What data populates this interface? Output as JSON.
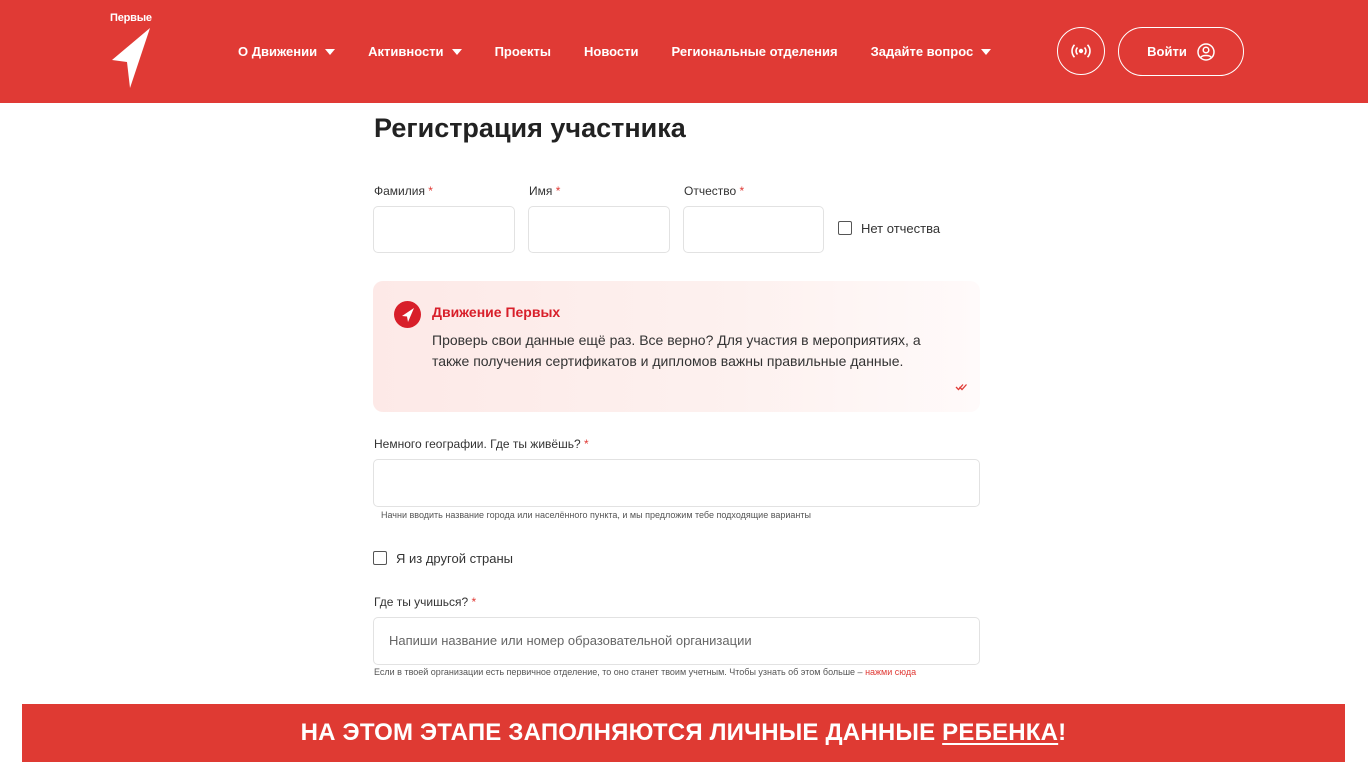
{
  "header": {
    "logo_text": "Первые",
    "nav": [
      {
        "label": "О Движении",
        "dropdown": true
      },
      {
        "label": "Активности",
        "dropdown": true
      },
      {
        "label": "Проекты",
        "dropdown": false
      },
      {
        "label": "Новости",
        "dropdown": false
      },
      {
        "label": "Региональные отделения",
        "dropdown": false
      },
      {
        "label": "Задайте вопрос",
        "dropdown": true
      }
    ],
    "login_label": "Войти",
    "radio_icon": "broadcast-icon",
    "user_icon": "user-circle-icon"
  },
  "form": {
    "title": "Регистрация участника",
    "required_mark": "*",
    "surname_label": "Фамилия",
    "name_label": "Имя",
    "patronymic_label": "Отчество",
    "no_patronymic_label": "Нет отчества",
    "notice": {
      "title": "Движение Первых",
      "text": "Проверь свои данные ещё раз. Все верно? Для участия в мероприятиях, а также получения сертификатов и дипломов важны правильные данные."
    },
    "geo_label": "Немного географии. Где ты живёшь?",
    "geo_hint": "Начни вводить название города или населённого пункта, и мы предложим тебе подходящие варианты",
    "other_country_label": "Я из другой страны",
    "school_label": "Где ты учишься?",
    "school_placeholder": "Напиши название или номер образовательной организации",
    "school_hint": "Если в твоей организации есть первичное отделение, то оно станет твоим учетным. Чтобы узнать об этом больше –",
    "school_hint_link": "нажми сюда"
  },
  "banner": {
    "text_before": "НА ЭТОМ ЭТАПЕ ЗАПОЛНЯЮТСЯ ЛИЧНЫЕ ДАННЫЕ ",
    "text_underlined": "РЕБЕНКА",
    "text_after": "!"
  },
  "colors": {
    "brand_red": "#e03a35",
    "notice_red": "#d81f2a"
  }
}
